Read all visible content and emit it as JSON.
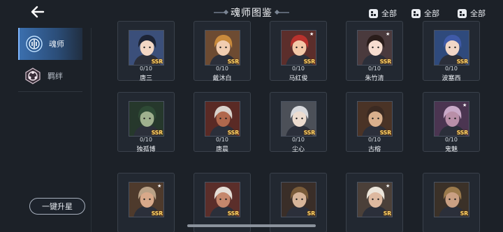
{
  "header": {
    "title": "魂师图鉴"
  },
  "filters": [
    {
      "label": "全部"
    },
    {
      "label": "全部"
    },
    {
      "label": "全部"
    }
  ],
  "sidebar": {
    "items": [
      {
        "label": "魂师",
        "active": true
      },
      {
        "label": "羁绊",
        "active": false
      }
    ]
  },
  "upgrade_button": {
    "label": "一键升星"
  },
  "cards": [
    {
      "name": "唐三",
      "count": "0/10",
      "rarity": "SSR",
      "hair": "#1d2436",
      "skin": "#f3d7c4",
      "bg": "#3b4f7a",
      "star": false
    },
    {
      "name": "戴沐白",
      "count": "0/10",
      "rarity": "SSR",
      "hair": "#c98a3c",
      "skin": "#f1cdb1",
      "bg": "#6d4b32",
      "star": false
    },
    {
      "name": "马红俊",
      "count": "0/10",
      "rarity": "SSR",
      "hair": "#b8322d",
      "skin": "#f4c9a8",
      "bg": "#5c2e2b",
      "star": true
    },
    {
      "name": "朱竹清",
      "count": "0/10",
      "rarity": "SSR",
      "hair": "#2a1d1b",
      "skin": "#f6ddd0",
      "bg": "#4a3a3d",
      "star": true
    },
    {
      "name": "波塞西",
      "count": "0/10",
      "rarity": "SSR",
      "hair": "#3f5aa8",
      "skin": "#f1d6c7",
      "bg": "#2f4a7c",
      "star": false
    },
    {
      "name": "独孤博",
      "count": "0/10",
      "rarity": "SSR",
      "hair": "#2e4a35",
      "skin": "#9fb08e",
      "bg": "#26382c",
      "star": false
    },
    {
      "name": "唐晨",
      "count": "0/10",
      "rarity": "SSR",
      "hair": "#d9d2cc",
      "skin": "#b0684d",
      "bg": "#5a2a25",
      "star": false
    },
    {
      "name": "尘心",
      "count": "0/10",
      "rarity": "SSR",
      "hair": "#d7d8dc",
      "skin": "#eddccf",
      "bg": "#4c5058",
      "star": false
    },
    {
      "name": "古榕",
      "count": "0/10",
      "rarity": "SSR",
      "hair": "#3b2a22",
      "skin": "#d9b08d",
      "bg": "#4a3326",
      "star": false
    },
    {
      "name": "鬼魅",
      "count": "0/10",
      "rarity": "SSR",
      "hair": "#c9a9c8",
      "skin": "#b98fa8",
      "bg": "#4b3551",
      "star": true
    },
    {
      "name": "",
      "count": "",
      "rarity": "SSR",
      "hair": "#b9a186",
      "skin": "#d8a98a",
      "bg": "#4e3a2c",
      "star": true
    },
    {
      "name": "",
      "count": "",
      "rarity": "SSR",
      "hair": "#e5ddd6",
      "skin": "#c5876c",
      "bg": "#5b2e2a",
      "star": false
    },
    {
      "name": "",
      "count": "",
      "rarity": "SR",
      "hair": "#7a5c3a",
      "skin": "#d7b59a",
      "bg": "#3a2e28",
      "star": false
    },
    {
      "name": "",
      "count": "",
      "rarity": "SR",
      "hair": "#ebe4d9",
      "skin": "#ddb9a0",
      "bg": "#4b4039",
      "star": true
    },
    {
      "name": "",
      "count": "",
      "rarity": "SR",
      "hair": "#9b7a4c",
      "skin": "#caa083",
      "bg": "#3b3128",
      "star": false
    }
  ]
}
